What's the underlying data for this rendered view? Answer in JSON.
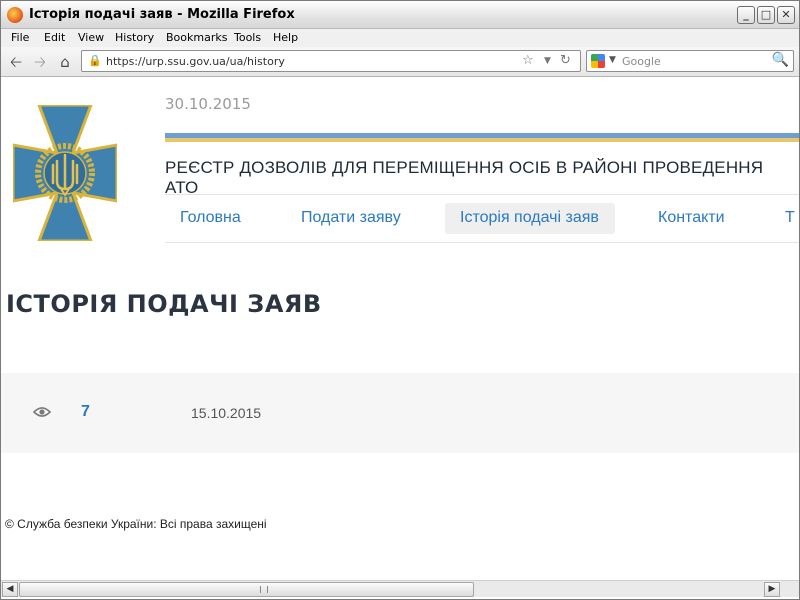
{
  "window": {
    "title": "Історія подачі заяв - Mozilla Firefox",
    "minimize": "_",
    "maximize": "□",
    "close": "✕"
  },
  "menubar": {
    "items": [
      "File",
      "Edit",
      "View",
      "History",
      "Bookmarks",
      "Tools",
      "Help"
    ]
  },
  "navbar": {
    "url": "https://urp.ssu.gov.ua/ua/history",
    "search_placeholder": "Google"
  },
  "icons": {
    "back": "back-arrow-icon",
    "forward": "forward-arrow-icon",
    "home": "home-icon",
    "lock": "lock-icon",
    "star": "bookmark-star-icon",
    "reload": "reload-icon",
    "search_engine": "google-icon",
    "magnifier": "search-icon",
    "eye": "eye-icon"
  },
  "header": {
    "date": "30.10.2015",
    "registry_title": "РЕЄСТР ДОЗВОЛІВ ДЛЯ ПЕРЕМІЩЕННЯ ОСІБ В РАЙОНІ ПРОВЕДЕННЯ АТО"
  },
  "menu": {
    "items": [
      {
        "label": "Головна"
      },
      {
        "label": "Подати заяву"
      },
      {
        "label": "Історія подачі заяв"
      },
      {
        "label": "Контакти"
      },
      {
        "label": "Т"
      }
    ],
    "active_index": 2
  },
  "page": {
    "title": "ІСТОРІЯ ПОДАЧІ ЗАЯВ"
  },
  "history": [
    {
      "count": "7",
      "date": "15.10.2015"
    }
  ],
  "footer": {
    "copyright": "© Служба безпеки України: Всі права захищені"
  },
  "colors": {
    "link": "#2a79c2",
    "stripe_blue": "#6e9fd0",
    "stripe_yellow": "#e6c76a",
    "emblem_blue": "#3f82b0",
    "emblem_gold": "#d8b43a"
  }
}
